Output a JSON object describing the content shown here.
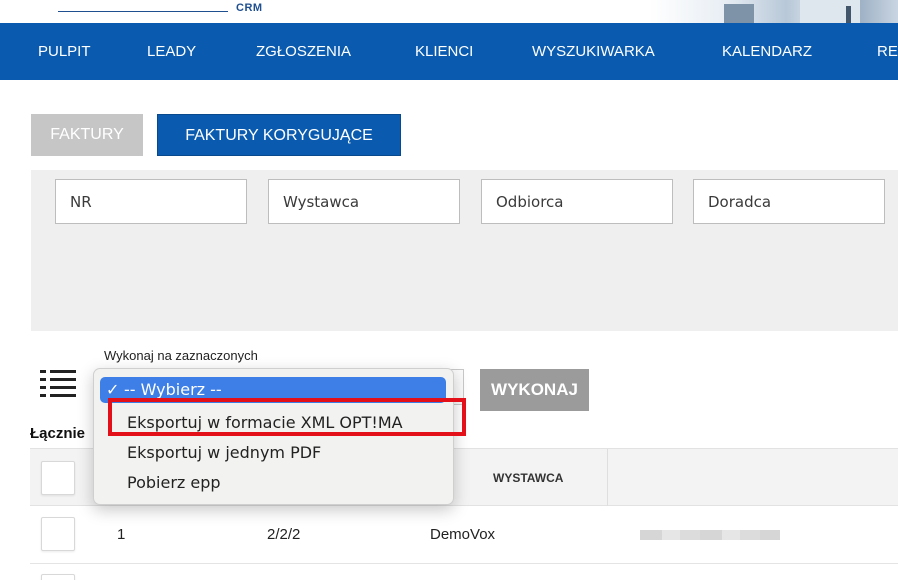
{
  "brand": {
    "logo_text": "CRM"
  },
  "nav": {
    "items": [
      {
        "label": "PULPIT"
      },
      {
        "label": "LEADY"
      },
      {
        "label": "ZGŁOSZENIA"
      },
      {
        "label": "KLIENCI"
      },
      {
        "label": "WYSZUKIWARKA"
      },
      {
        "label": "KALENDARZ"
      },
      {
        "label": "RE"
      }
    ]
  },
  "tabs": [
    {
      "label": "FAKTURY",
      "active": false
    },
    {
      "label": "FAKTURY KORYGUJĄCE",
      "active": true
    }
  ],
  "filters": {
    "nr_placeholder": "NR",
    "wystawca_placeholder": "Wystawca",
    "odbiorca_placeholder": "Odbiorca",
    "doradca_placeholder": "Doradca"
  },
  "bulk": {
    "label": "Wykonaj na zaznaczonych",
    "run_label": "WYKONAJ",
    "options": [
      {
        "label": "-- Wybierz --",
        "selected": true,
        "check": "✓"
      },
      {
        "label": "Eksportuj w formacie XML OPT!MA",
        "selected": false
      },
      {
        "label": "Eksportuj w jednym PDF",
        "selected": false
      },
      {
        "label": "Pobierz epp",
        "selected": false
      }
    ],
    "list_icon": "list-icon"
  },
  "summary": {
    "total_label": "Łącznie"
  },
  "table": {
    "columns": [
      {
        "label": "WYSTAWCA"
      }
    ],
    "rows": [
      {
        "lp": "1",
        "nr": "2/2/2",
        "wystawca": "DemoVox"
      }
    ]
  },
  "colors": {
    "primary": "#0a5bb0",
    "tab_inactive": "#c6c6c6",
    "button_gray": "#9b9b9b",
    "highlight": "#e3101a",
    "selected_option": "#3d7fe6"
  }
}
